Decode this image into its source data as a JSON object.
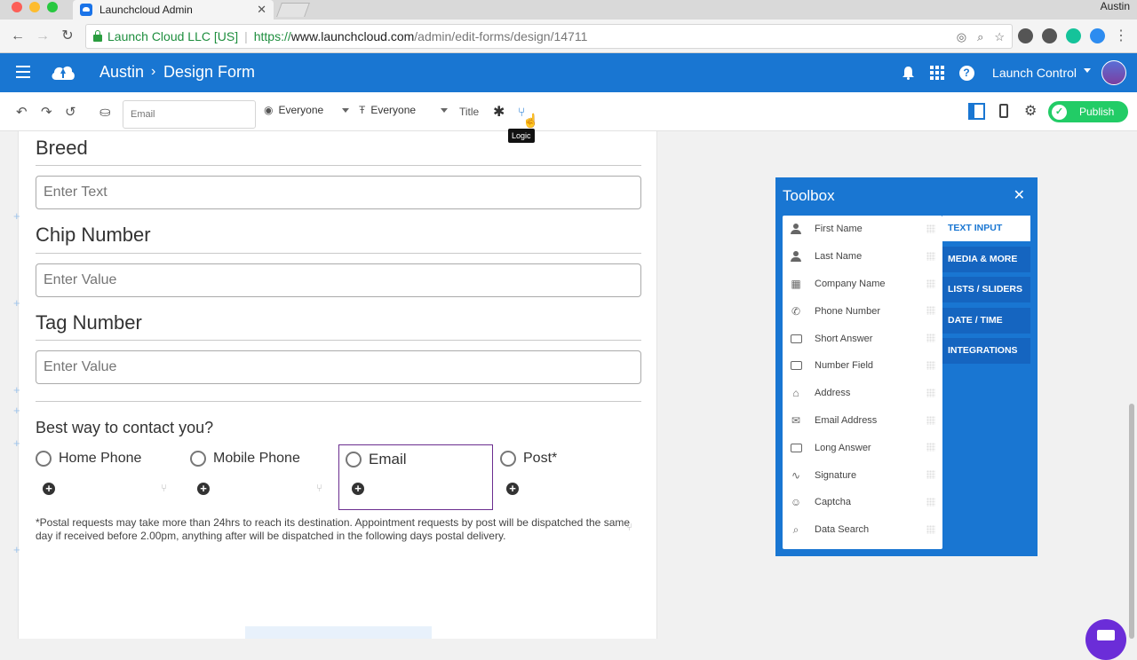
{
  "browser": {
    "tab_title": "Launchcloud Admin",
    "tab_close": "✕",
    "profile_name": "Austin",
    "secure_label": "Launch Cloud LLC [US]",
    "url_scheme": "https://",
    "url_host": "www.launchcloud.com",
    "url_path": "/admin/edit-forms/design/14711"
  },
  "header": {
    "breadcrumb_root": "Austin",
    "breadcrumb_sep": "›",
    "breadcrumb_page": "Design Form",
    "account_label": "Launch Control"
  },
  "editor_toolbar": {
    "email_placeholder": "Email",
    "visibility_1": "Everyone",
    "visibility_2": "Everyone",
    "title_label": "Title",
    "logic_tooltip": "Logic",
    "publish_label": "Publish"
  },
  "form": {
    "fields": [
      {
        "label": "Breed",
        "placeholder": "Enter Text"
      },
      {
        "label": "Chip Number",
        "placeholder": "Enter Value"
      },
      {
        "label": "Tag Number",
        "placeholder": "Enter Value"
      }
    ],
    "contact_question": "Best way to contact you?",
    "options": [
      "Home Phone",
      "Mobile Phone",
      "Email",
      "Post*"
    ],
    "selected_option": "Email",
    "note": "*Postal requests may take more than 24hrs to reach its destination. Appointment requests by post will be dispatched the same day if received before 2.00pm, anything after will be dispatched in the following days postal delivery."
  },
  "toolbox": {
    "title": "Toolbox",
    "close": "✕",
    "items": [
      {
        "label": "First Name",
        "icon": "person-icon"
      },
      {
        "label": "Last Name",
        "icon": "person-icon"
      },
      {
        "label": "Company Name",
        "icon": "building-icon"
      },
      {
        "label": "Phone Number",
        "icon": "phone-icon"
      },
      {
        "label": "Short Answer",
        "icon": "input-box-icon"
      },
      {
        "label": "Number Field",
        "icon": "input-box-icon"
      },
      {
        "label": "Address",
        "icon": "home-icon"
      },
      {
        "label": "Email Address",
        "icon": "envelope-icon"
      },
      {
        "label": "Long Answer",
        "icon": "input-box-icon"
      },
      {
        "label": "Signature",
        "icon": "signature-icon"
      },
      {
        "label": "Captcha",
        "icon": "face-icon"
      },
      {
        "label": "Data Search",
        "icon": "search-icon"
      }
    ],
    "tabs": [
      "TEXT INPUT",
      "MEDIA & MORE",
      "LISTS / SLIDERS",
      "DATE / TIME",
      "INTEGRATIONS"
    ],
    "active_tab": "TEXT INPUT"
  },
  "colors": {
    "brand_blue": "#1976d2",
    "publish_green": "#22cc66",
    "selected_outline": "#6b2d8f"
  }
}
